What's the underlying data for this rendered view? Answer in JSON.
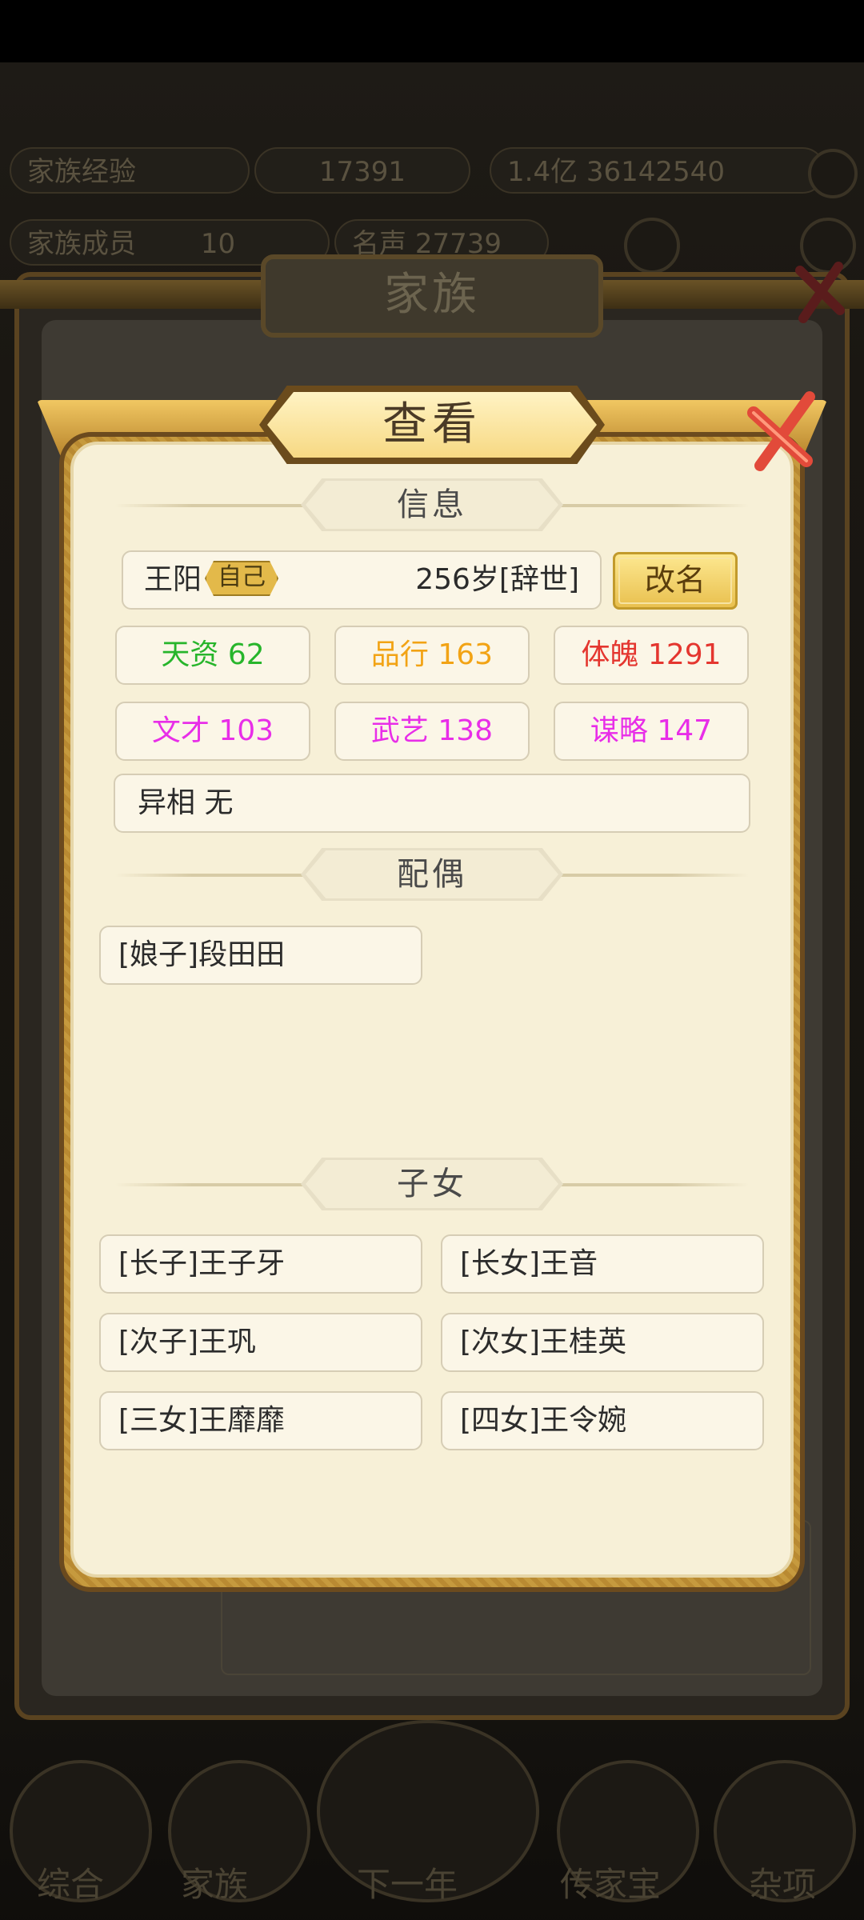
{
  "background": {
    "top_stats": [
      "家族经验",
      "17391",
      "1.4亿",
      "36142540"
    ],
    "second_stats": [
      "家族成员",
      "10",
      "名声",
      "27739"
    ],
    "window_title": "家族",
    "bottom_tabs": [
      "综合",
      "家族",
      "下一年",
      "传家宝",
      "杂项"
    ]
  },
  "dialog": {
    "title": "查看",
    "info_header": "信息",
    "name": "王阳",
    "self_tag": "自己",
    "age_status": "256岁[辞世]",
    "rename_label": "改名",
    "stats": [
      {
        "label": "天资",
        "value": "62",
        "color": "#27b52b"
      },
      {
        "label": "品行",
        "value": "163",
        "color": "#f2a314"
      },
      {
        "label": "体魄",
        "value": "1291",
        "color": "#e4362f"
      },
      {
        "label": "文才",
        "value": "103",
        "color": "#e82ee8"
      },
      {
        "label": "武艺",
        "value": "138",
        "color": "#e82ee8"
      },
      {
        "label": "谋略",
        "value": "147",
        "color": "#e82ee8"
      }
    ],
    "trait_label": "异相 无",
    "spouse_header": "配偶",
    "spouses": [
      "[娘子]段田田"
    ],
    "children_header": "子女",
    "children": [
      "[长子]王子牙",
      "[长女]王音",
      "[次子]王巩",
      "[次女]王桂英",
      "[三女]王靡靡",
      "[四女]王令婉"
    ]
  }
}
